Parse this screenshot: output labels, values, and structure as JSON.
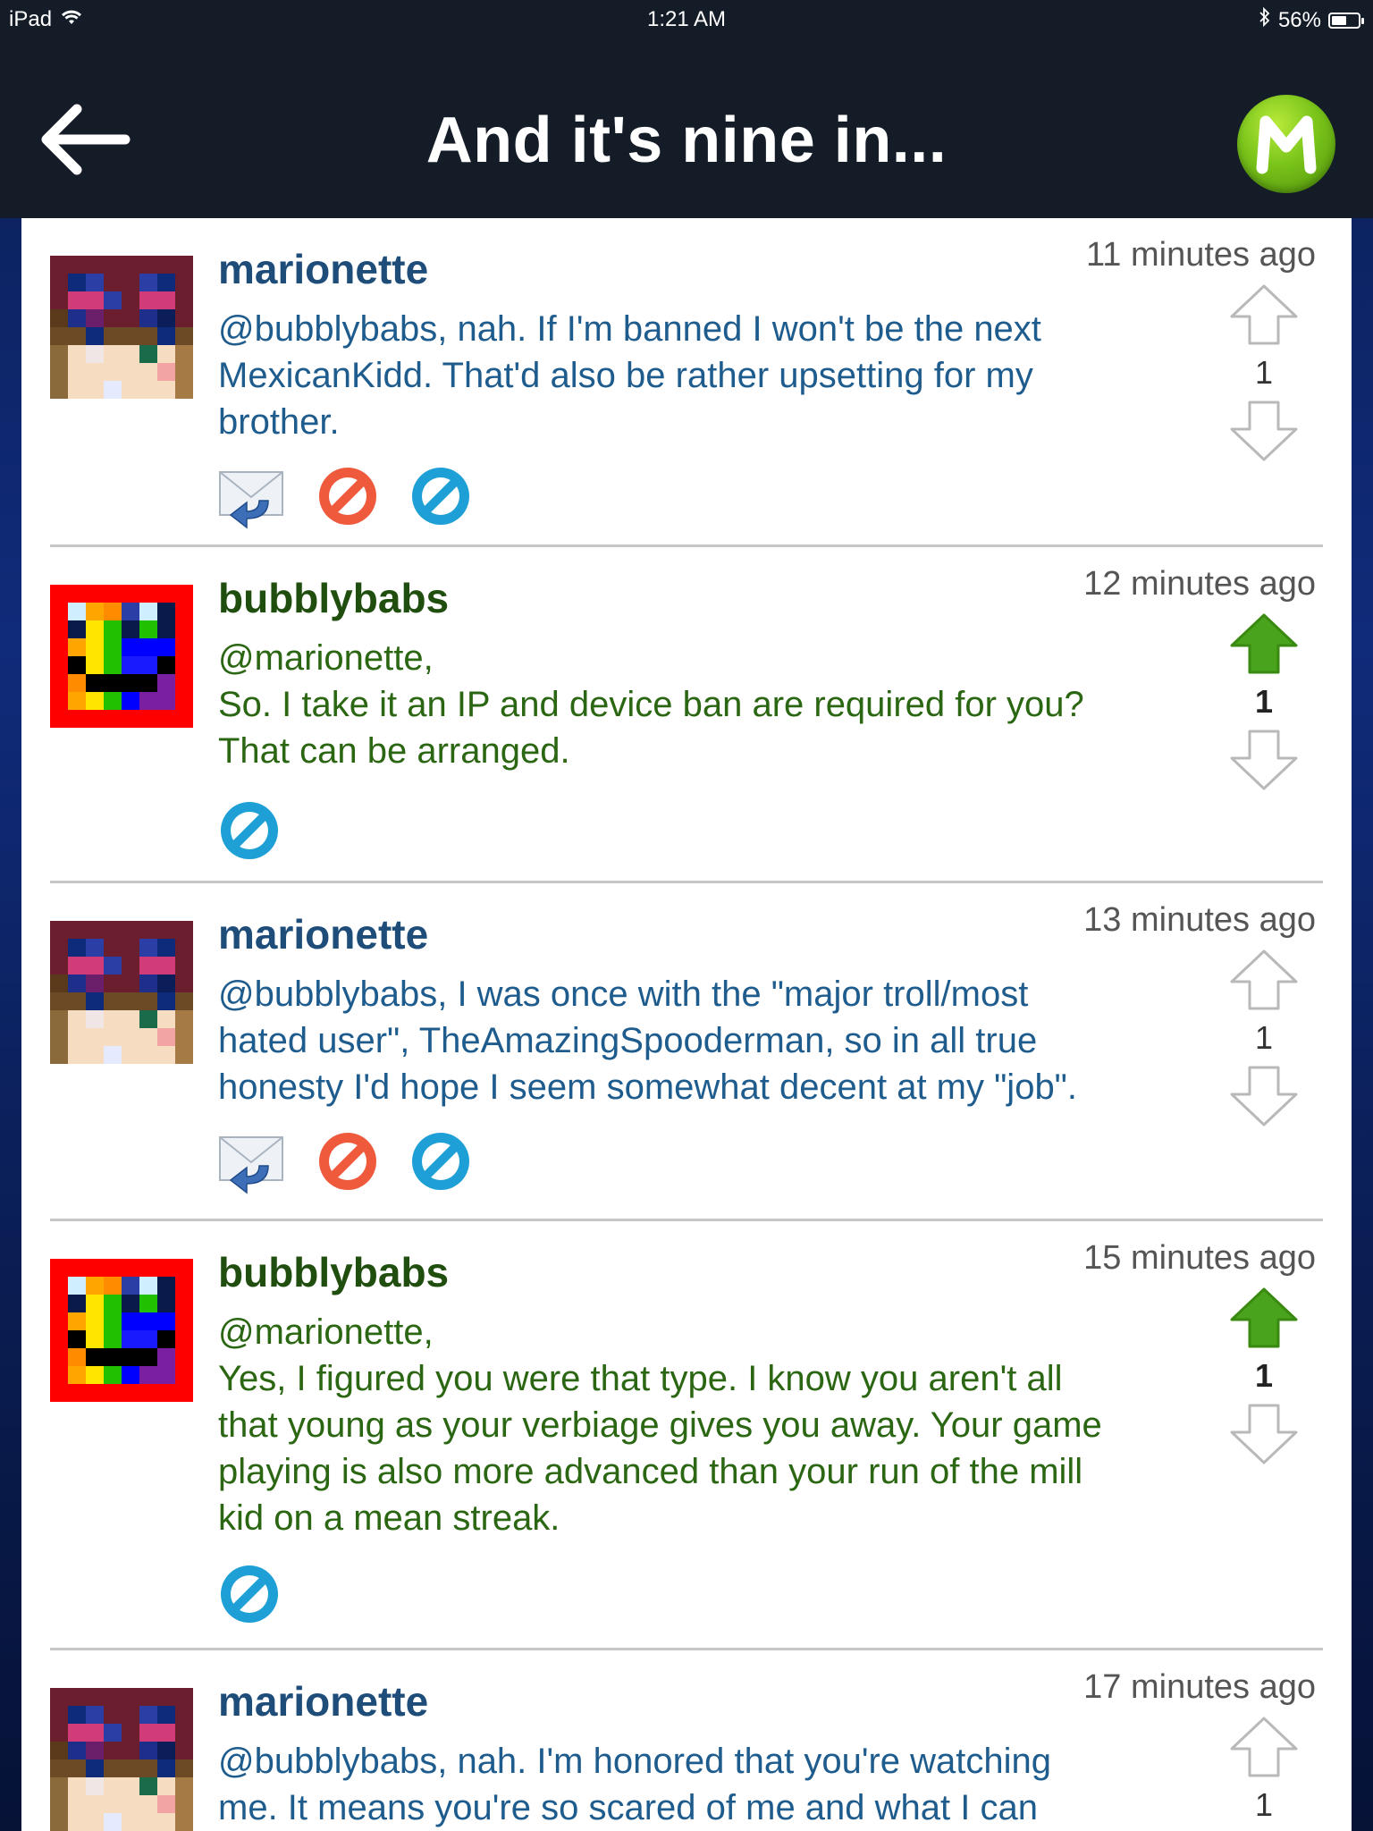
{
  "status": {
    "device": "iPad",
    "time": "1:21 AM",
    "battery": "56%",
    "battery_level": 0.56
  },
  "header": {
    "title": "And it's nine in...",
    "logo_letter": "M"
  },
  "posts": [
    {
      "user": "marionette",
      "time": "11 minutes ago",
      "lines": [
        "@bubblybabs, nah. If I'm banned I won't be the next",
        "MexicanKidd. That'd also be rather upsetting for my",
        "brother."
      ],
      "votes": "1",
      "upvoted": false
    },
    {
      "user": "bubblybabs",
      "time": "12 minutes ago",
      "lines": [
        "@marionette,",
        "So. I take it an IP and device ban are required for you?",
        "That can be arranged."
      ],
      "votes": "1",
      "upvoted": true
    },
    {
      "user": "marionette",
      "time": "13 minutes ago",
      "lines": [
        "@bubblybabs, I was once with the \"major troll/most",
        "hated user\", TheAmazingSpooderman, so in all true",
        "honesty I'd hope I seem somewhat decent at my \"job\"."
      ],
      "votes": "1",
      "upvoted": false
    },
    {
      "user": "bubblybabs",
      "time": "15 minutes ago",
      "lines": [
        "@marionette,",
        "Yes, I figured you were that type. I know you aren't all",
        "that young as your verbiage gives you away. Your game",
        "playing is also more advanced than your run of the mill",
        "kid on a mean streak."
      ],
      "votes": "1",
      "upvoted": true
    },
    {
      "user": "marionette",
      "time": "17 minutes ago",
      "lines": [
        "@bubblybabs, nah. I'm honored that you're watching",
        "me. It means you're so scared of me and what I can"
      ],
      "votes": "1",
      "upvoted": false
    }
  ],
  "icons": {
    "reply": "reply-mail-icon",
    "block": "block-icon",
    "moderate": "moderate-icon",
    "upvote": "upvote-arrow-icon",
    "downvote": "downvote-arrow-icon",
    "back": "back-arrow-icon"
  },
  "colors": {
    "marionette_text": "#1f5c8e",
    "bubblybabs_text": "#2b6612",
    "upvote_active": "#4aa31c",
    "navbar": "#141c28"
  }
}
